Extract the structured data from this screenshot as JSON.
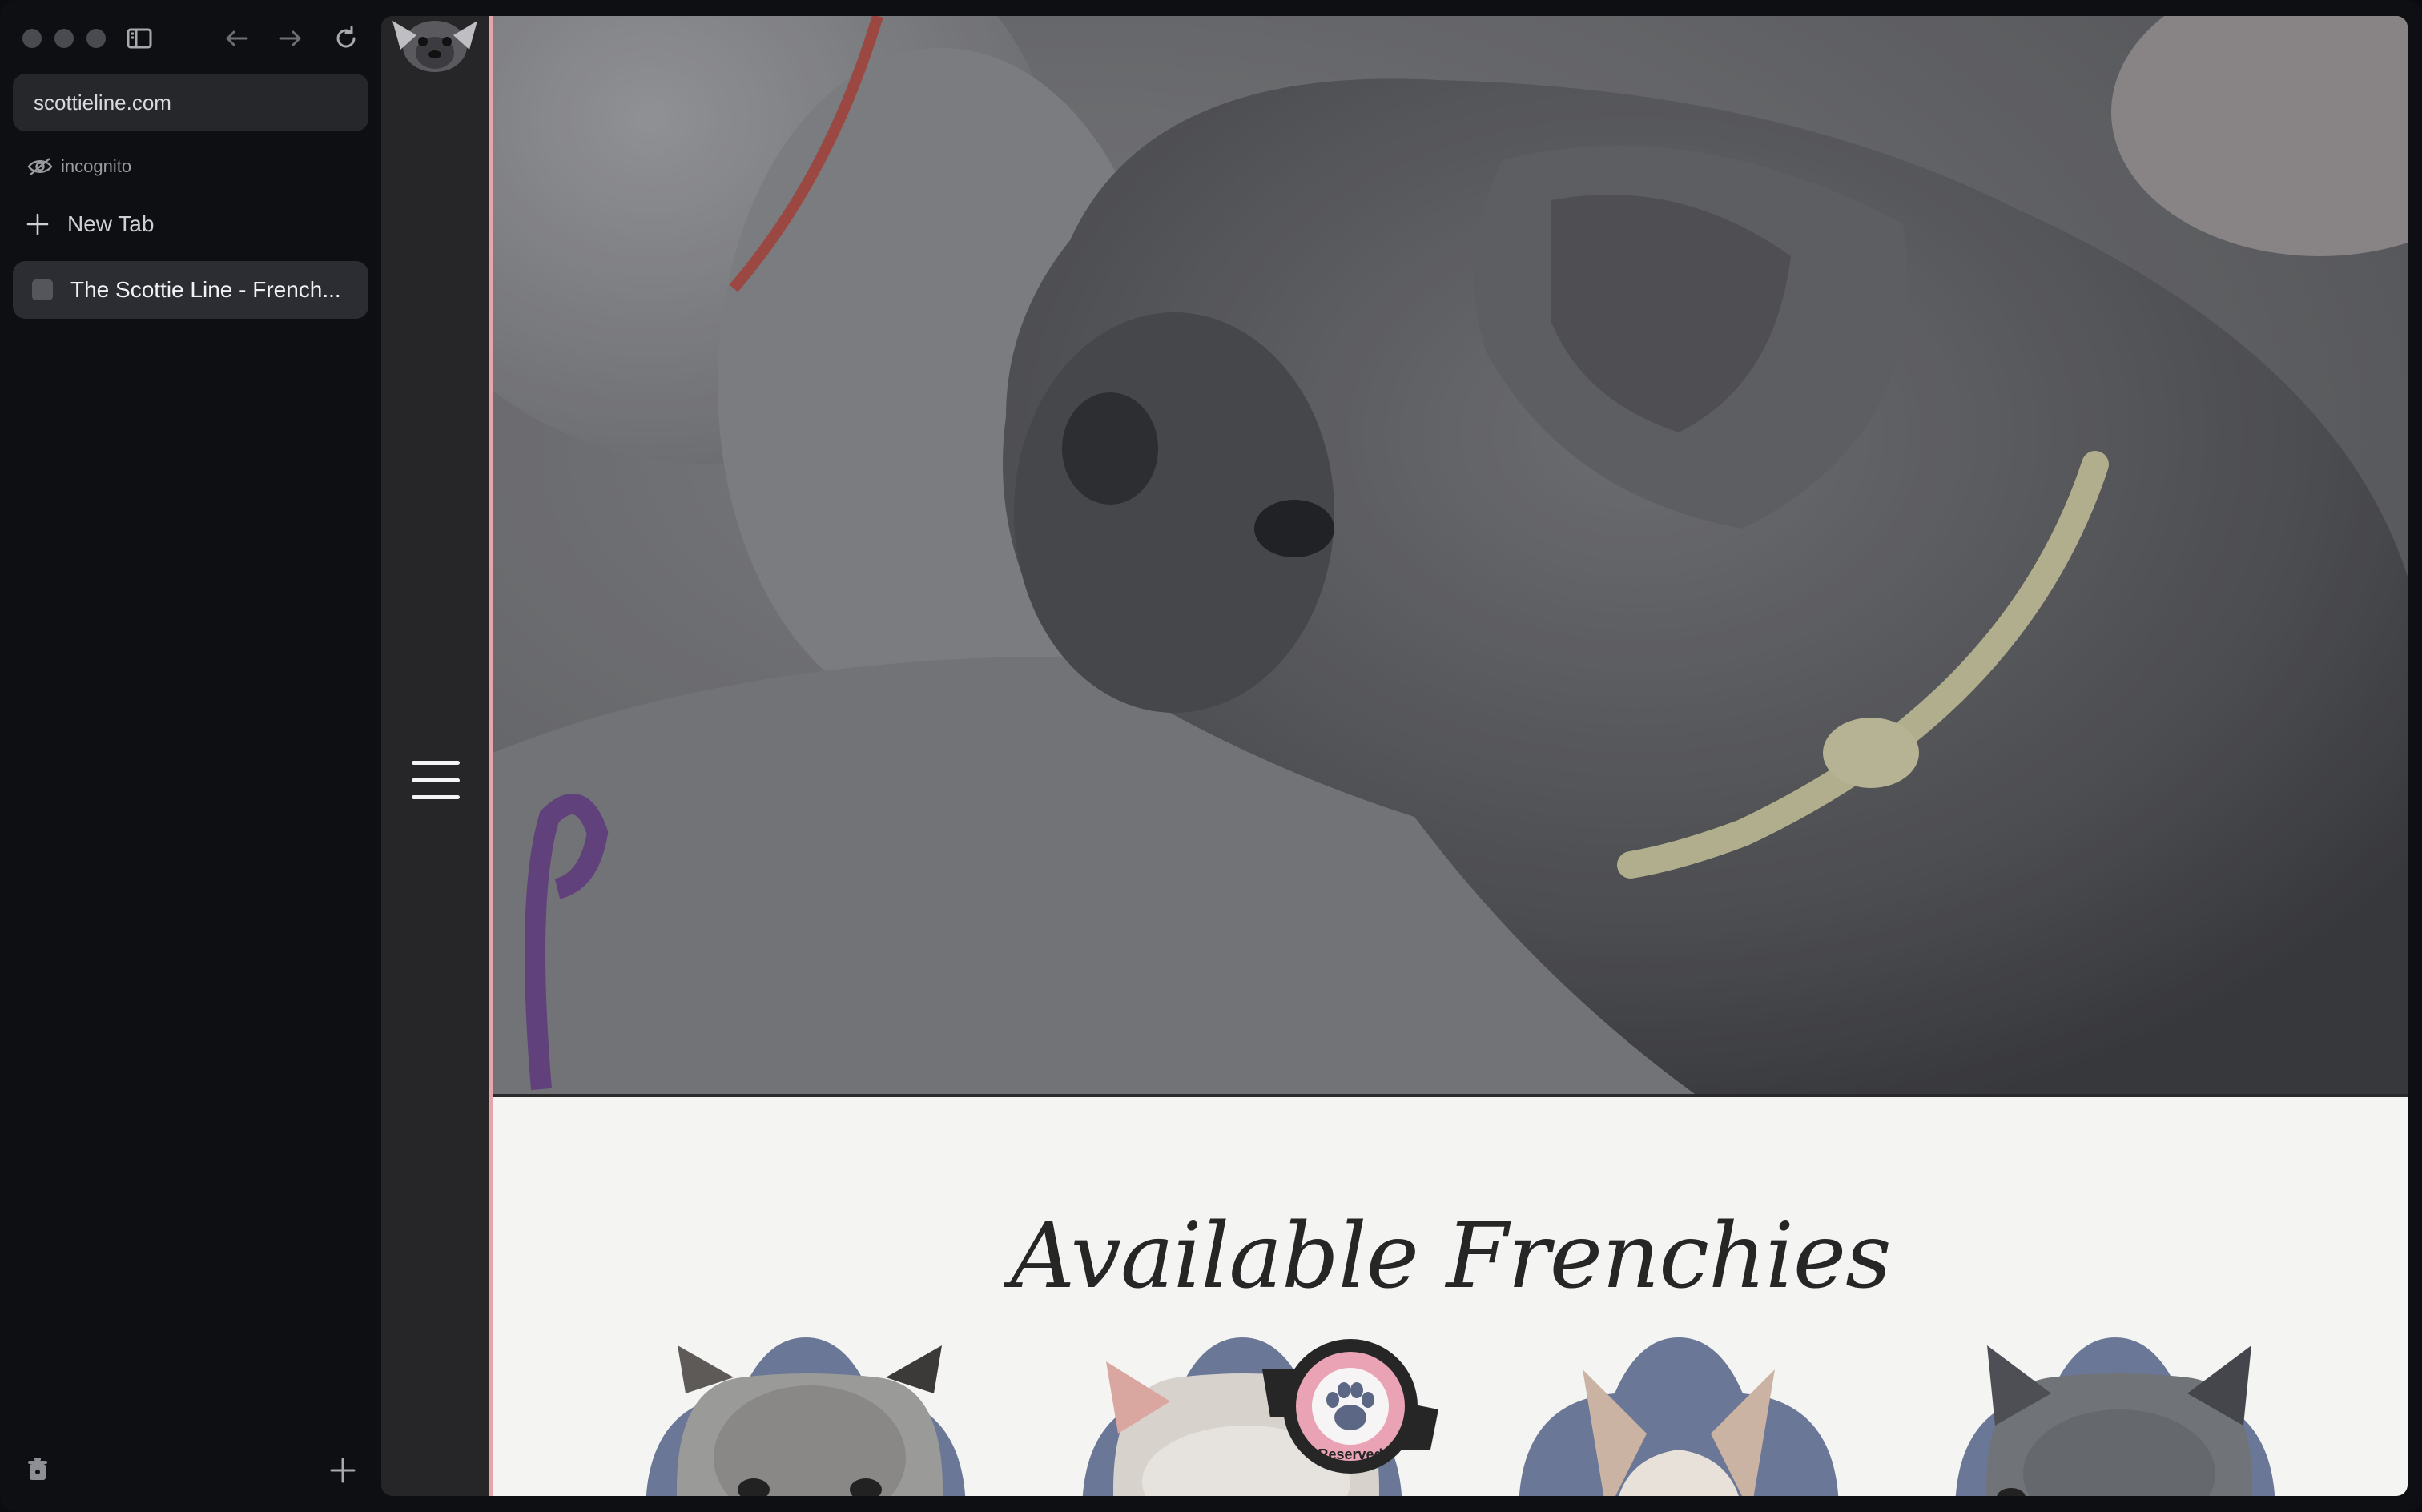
{
  "browser": {
    "url": "scottieline.com",
    "incognito_label": "incognito",
    "new_tab_label": "New Tab",
    "tabs": [
      {
        "title": "The Scottie Line - French..."
      }
    ]
  },
  "site": {
    "section_title": "Available Frenchies",
    "cards": [
      {
        "status": "available"
      },
      {
        "status": "reserved",
        "badge_text": "Reserved"
      },
      {
        "status": "available"
      },
      {
        "status": "available"
      }
    ],
    "colors": {
      "accent_line": "#e8a4ab",
      "card_backdrop": "#6a7796",
      "badge_pink": "#e9a3b4",
      "section_bg": "#f4f4f2"
    }
  }
}
